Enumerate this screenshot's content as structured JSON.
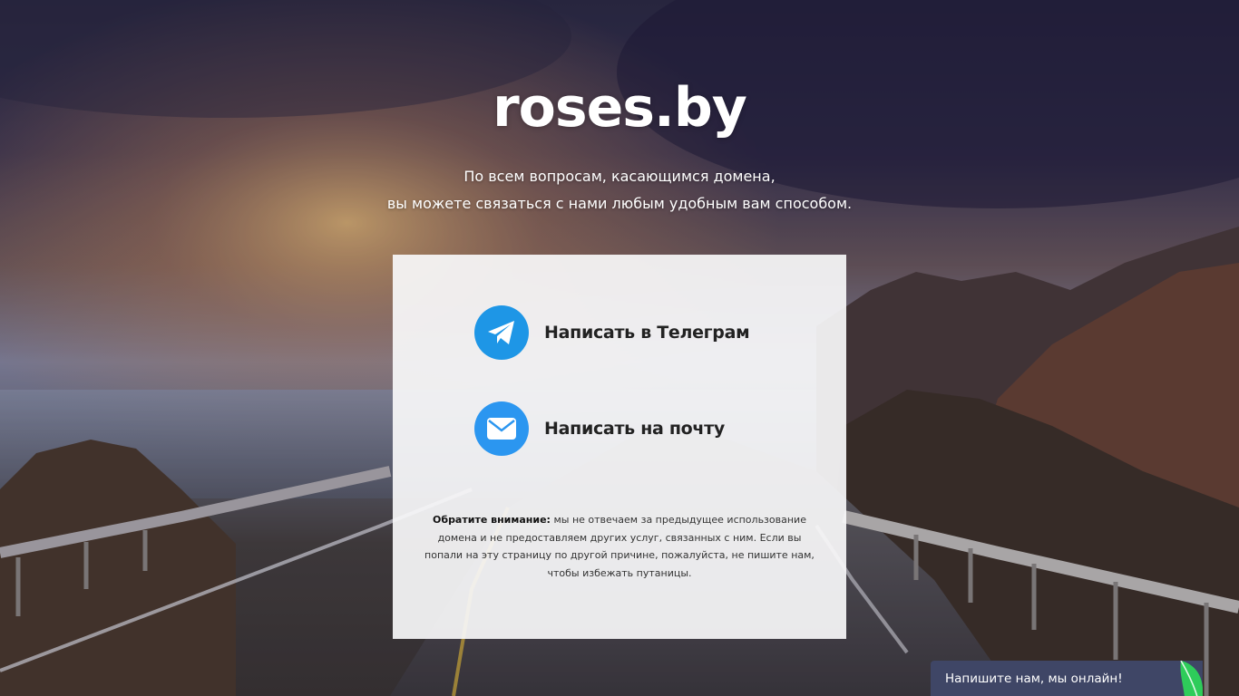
{
  "site": {
    "title": "roses.by",
    "subtitle_line1": "По всем вопросам, касающимся домена,",
    "subtitle_line2": "вы можете связаться с нами любым удобным вам способом."
  },
  "contacts": [
    {
      "label": "Написать в Телеграм",
      "icon": "telegram-icon",
      "color": "#1e96e6"
    },
    {
      "label": "Написать на почту",
      "icon": "mail-icon",
      "color": "#2b96f0"
    }
  ],
  "notice": {
    "bold": "Обратите внимание:",
    "text": " мы не отвечаем за предыдущее использование домена и не предоставляем других услуг, связанных с ним. Если вы попали на эту страницу по другой причине, пожалуйста, не пишите нам, чтобы избежать путаницы."
  },
  "chat": {
    "label": "Напишите нам, мы онлайн!",
    "icon": "leaf-icon",
    "bg_color": "#3f4666",
    "accent_color": "#2ecc5a"
  }
}
